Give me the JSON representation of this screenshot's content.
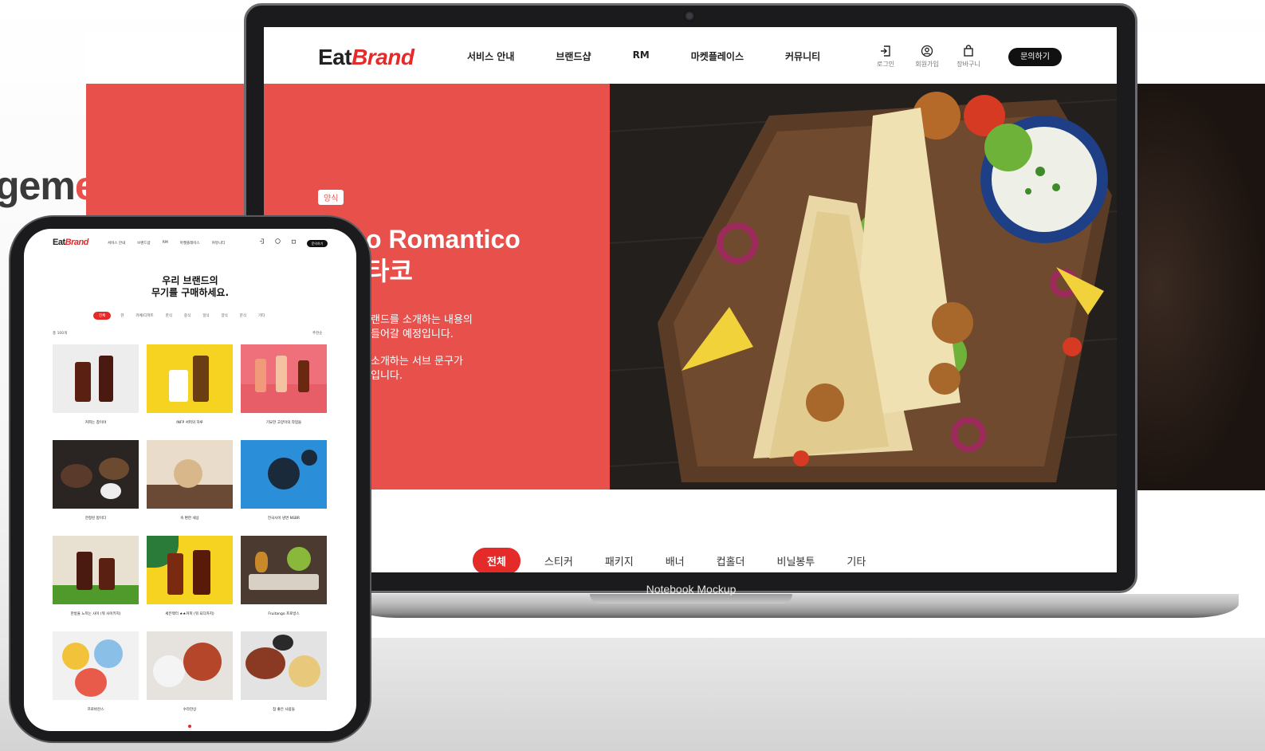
{
  "background": {
    "headline_partial_plain": "gem",
    "headline_partial_accent": "ent",
    "brand_red": "#e8504c"
  },
  "laptop": {
    "mockup_label": "Notebook Mockup",
    "logo": {
      "eat": "Eat",
      "brand": "Brand"
    },
    "nav": [
      "서비스 안내",
      "브랜드샵",
      "RM",
      "마켓플레이스",
      "커뮤니티"
    ],
    "utilities": [
      {
        "icon": "login-icon",
        "label": "로그인"
      },
      {
        "icon": "user-icon",
        "label": "회원가입"
      },
      {
        "icon": "shopping-bag-icon",
        "label": "장바구니"
      }
    ],
    "cta": "문의하기",
    "hero": {
      "tag": "양식",
      "title_line1": "o Romantico",
      "title_line2": "타코",
      "desc_line1": "랜드를 소개하는 내용의",
      "desc_line2": "들어갈 예정입니다.",
      "sub_line1": "소개하는 서브 문구가",
      "sub_line2": "입니다."
    },
    "tabs": [
      "전체",
      "스티커",
      "패키지",
      "배너",
      "컵홀더",
      "비닐봉투",
      "기타"
    ]
  },
  "tablet": {
    "logo": {
      "eat": "Eat",
      "brand": "Brand"
    },
    "nav": [
      "서비스 안내",
      "브랜드샵",
      "RM",
      "마켓플레이스",
      "커뮤니티"
    ],
    "cta": "문의하기",
    "heading_line1": "우리 브랜드의",
    "heading_line2": "무기를 구매하세요.",
    "categories": [
      "전체",
      "한",
      "카페/디저트",
      "한식",
      "중식",
      "일식",
      "양식",
      "분식",
      "기타"
    ],
    "count": "총 100개",
    "sort": "추천순",
    "products": [
      {
        "caption": "커피는 참이야"
      },
      {
        "caption": "INFP 서퍼의 하루"
      },
      {
        "caption": "기묘한 고양이의 작업들"
      },
      {
        "caption": "한정된 밥이다"
      },
      {
        "caption": "속 편한 세상"
      },
      {
        "caption": "전국사이 냉면 NSBR"
      },
      {
        "caption": "한방울 느끼는 사이 (뭐 사이키지)"
      },
      {
        "caption": "세븐젝터 ★★커피 (뭐 되다카지)"
      },
      {
        "caption": "Fruitango 프로방스"
      },
      {
        "caption": "프로바잔스"
      },
      {
        "caption": "수라한상"
      },
      {
        "caption": "참 좋은 사람들"
      }
    ]
  }
}
